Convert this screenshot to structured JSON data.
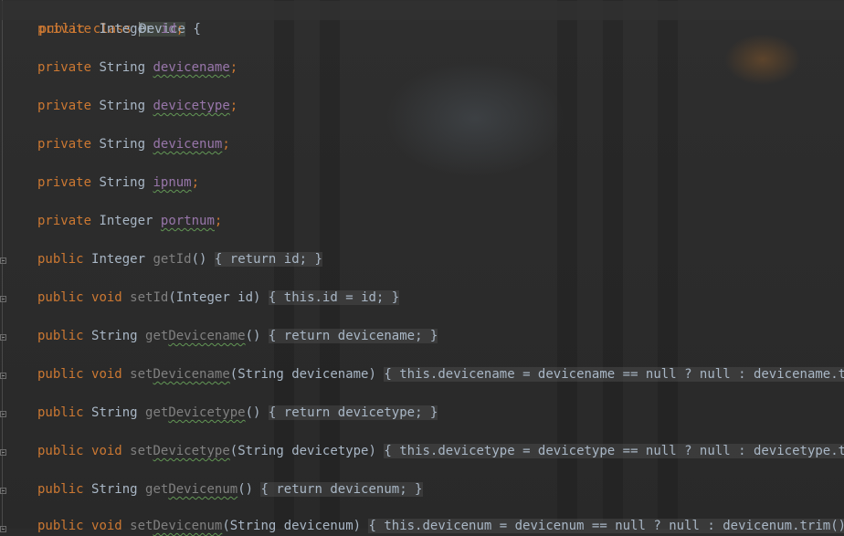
{
  "editor": {
    "class_decl": {
      "public": "public",
      "class": "class",
      "name": "Device",
      "brace": "{"
    },
    "fields": [
      {
        "mod": "private",
        "type": "Integer",
        "name": "id",
        "semi": ";"
      },
      {
        "mod": "private",
        "type": "String",
        "name": "devicename",
        "semi": ";"
      },
      {
        "mod": "private",
        "type": "String",
        "name": "devicetype",
        "semi": ";"
      },
      {
        "mod": "private",
        "type": "String",
        "name": "devicenum",
        "semi": ";"
      },
      {
        "mod": "private",
        "type": "String",
        "name": "ipnum",
        "semi": ";"
      },
      {
        "mod": "private",
        "type": "Integer",
        "name": "portnum",
        "semi": ";"
      }
    ],
    "methods": [
      {
        "mod": "public",
        "ret": "Integer",
        "name_pre": "getId",
        "name_under": "",
        "params": "()",
        "body": "{ return id; }"
      },
      {
        "mod": "public",
        "ret": "void",
        "name_pre": "setId",
        "name_under": "",
        "params": "(Integer id)",
        "body": "{ this.id = id; }"
      },
      {
        "mod": "public",
        "ret": "String",
        "name_pre": "get",
        "name_under": "Devicename",
        "params": "()",
        "body": "{ return devicename; }"
      },
      {
        "mod": "public",
        "ret": "void",
        "name_pre": "set",
        "name_under": "Devicename",
        "params": "(String devicename)",
        "body": "{ this.devicename = devicename == null ? null : devicename.trim()"
      },
      {
        "mod": "public",
        "ret": "String",
        "name_pre": "get",
        "name_under": "Devicetype",
        "params": "()",
        "body": "{ return devicetype; }"
      },
      {
        "mod": "public",
        "ret": "void",
        "name_pre": "set",
        "name_under": "Devicetype",
        "params": "(String devicetype)",
        "body": "{ this.devicetype = devicetype == null ? null : devicetype.trim()"
      },
      {
        "mod": "public",
        "ret": "String",
        "name_pre": "get",
        "name_under": "Devicenum",
        "params": "()",
        "body": "{ return devicenum; }"
      },
      {
        "mod": "public",
        "ret": "void",
        "name_pre": "set",
        "name_under": "Devicenum",
        "params": "(String devicenum)",
        "body": "{ this.devicenum = devicenum == null ? null : devicenum.trim(); }"
      }
    ]
  },
  "colors": {
    "keyword": "#cc7832",
    "field": "#9876aa",
    "text": "#a9b7c6",
    "background": "#2b2b2b"
  }
}
